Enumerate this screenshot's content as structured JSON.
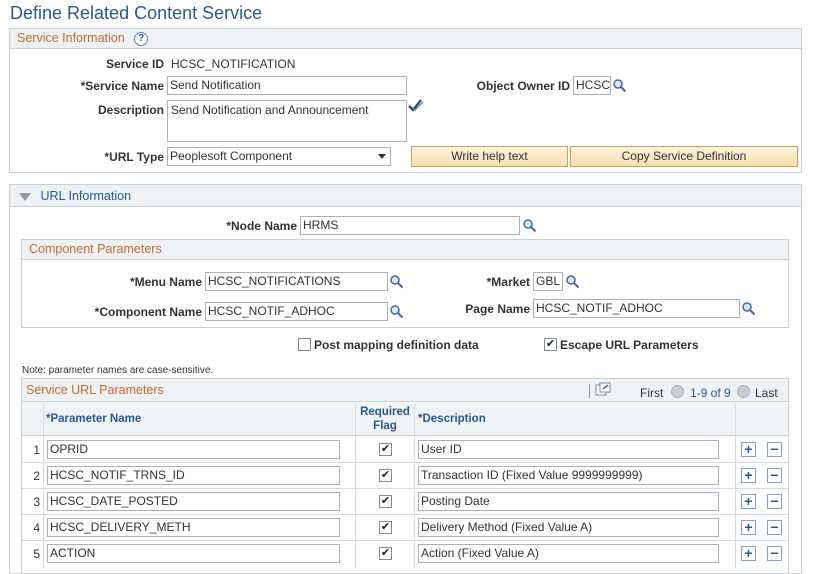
{
  "page_title": "Define Related Content Service",
  "service_info": {
    "header": "Service Information",
    "help_glyph": "?",
    "service_id_label": "Service ID",
    "service_id_value": "HCSC_NOTIFICATION",
    "service_name_label": "*Service Name",
    "service_name_value": "Send Notification",
    "object_owner_label": "Object Owner ID",
    "object_owner_value": "HCSC",
    "description_label": "Description",
    "description_value": "Send Notification and Announcement",
    "url_type_label": "*URL Type",
    "url_type_value": "Peoplesoft Component",
    "write_help_label": "Write help text",
    "copy_service_label": "Copy Service Definition"
  },
  "url_info": {
    "header": "URL Information",
    "node_name_label": "*Node Name",
    "node_name_value": "HRMS"
  },
  "component_params": {
    "header": "Component Parameters",
    "menu_name_label": "*Menu Name",
    "menu_name_value": "HCSC_NOTIFICATIONS",
    "market_label": "*Market",
    "market_value": "GBL",
    "component_name_label": "*Component Name",
    "component_name_value": "HCSC_NOTIF_ADHOC",
    "page_name_label": "Page Name",
    "page_name_value": "HCSC_NOTIF_ADHOC"
  },
  "options": {
    "post_mapping_label": "Post mapping definition data",
    "post_mapping_checked": false,
    "escape_url_label": "Escape URL Parameters",
    "escape_url_checked": true
  },
  "note_text": "Note: parameter names are case-sensitive.",
  "service_url_params": {
    "header": "Service URL Parameters",
    "nav_first": "First",
    "nav_range": "1-9 of 9",
    "nav_last": "Last",
    "columns": {
      "param_name": "*Parameter Name",
      "required_flag_line1": "Required",
      "required_flag_line2": "Flag",
      "description": "*Description"
    },
    "rows": [
      {
        "num": "1",
        "param": "OPRID",
        "required": true,
        "description": "User ID"
      },
      {
        "num": "2",
        "param": "HCSC_NOTIF_TRNS_ID",
        "required": true,
        "description": "Transaction ID (Fixed Value 9999999999)"
      },
      {
        "num": "3",
        "param": "HCSC_DATE_POSTED",
        "required": true,
        "description": "Posting Date"
      },
      {
        "num": "4",
        "param": "HCSC_DELIVERY_METH",
        "required": true,
        "description": "Delivery Method (Fixed Value A)"
      },
      {
        "num": "5",
        "param": "ACTION",
        "required": true,
        "description": "Action (Fixed Value A)"
      }
    ],
    "add_glyph": "+",
    "remove_glyph": "−"
  },
  "icons": {
    "lookup": "magnifier-icon",
    "spellcheck": "spellcheck-icon",
    "collapse": "triangle-down-icon",
    "view_all": "view-all-icon",
    "prev": "prev-arrow-icon",
    "next": "next-arrow-icon"
  },
  "colors": {
    "title": "#2b5a8a",
    "section_header": "#c4692f",
    "button_fill": "#f6dfae"
  }
}
